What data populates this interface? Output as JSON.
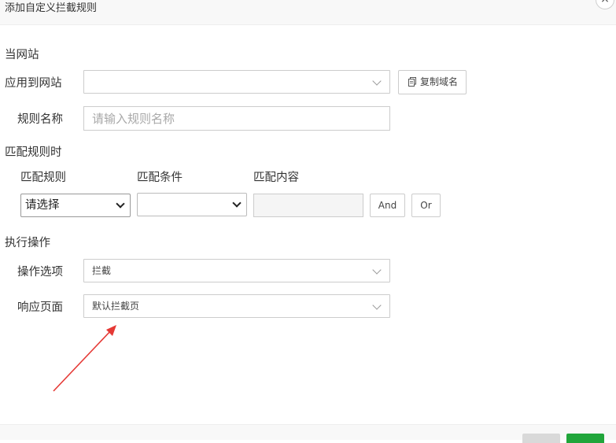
{
  "dialog": {
    "title": "添加自定义拦截规则",
    "close_icon": "×"
  },
  "site_section": {
    "label": "当网站",
    "apply_label": "应用到网站",
    "apply_value": "",
    "copy_domain_button": "复制域名",
    "rule_name_label": "规则名称",
    "rule_name_placeholder": "请输入规则名称"
  },
  "match_section": {
    "label": "匹配规则时",
    "col_rule": "匹配规则",
    "col_condition": "匹配条件",
    "col_content": "匹配内容",
    "rule_select": "请选择",
    "condition_select": "",
    "content_value": "",
    "and_button": "And",
    "or_button": "Or"
  },
  "action_section": {
    "label": "执行操作",
    "option_label": "操作选项",
    "option_value": "拦截",
    "response_label": "响应页面",
    "response_value": "默认拦截页"
  },
  "colors": {
    "annotation_arrow": "#e53935",
    "primary_button": "#20a53a",
    "secondary_button": "#d9d9d9"
  }
}
